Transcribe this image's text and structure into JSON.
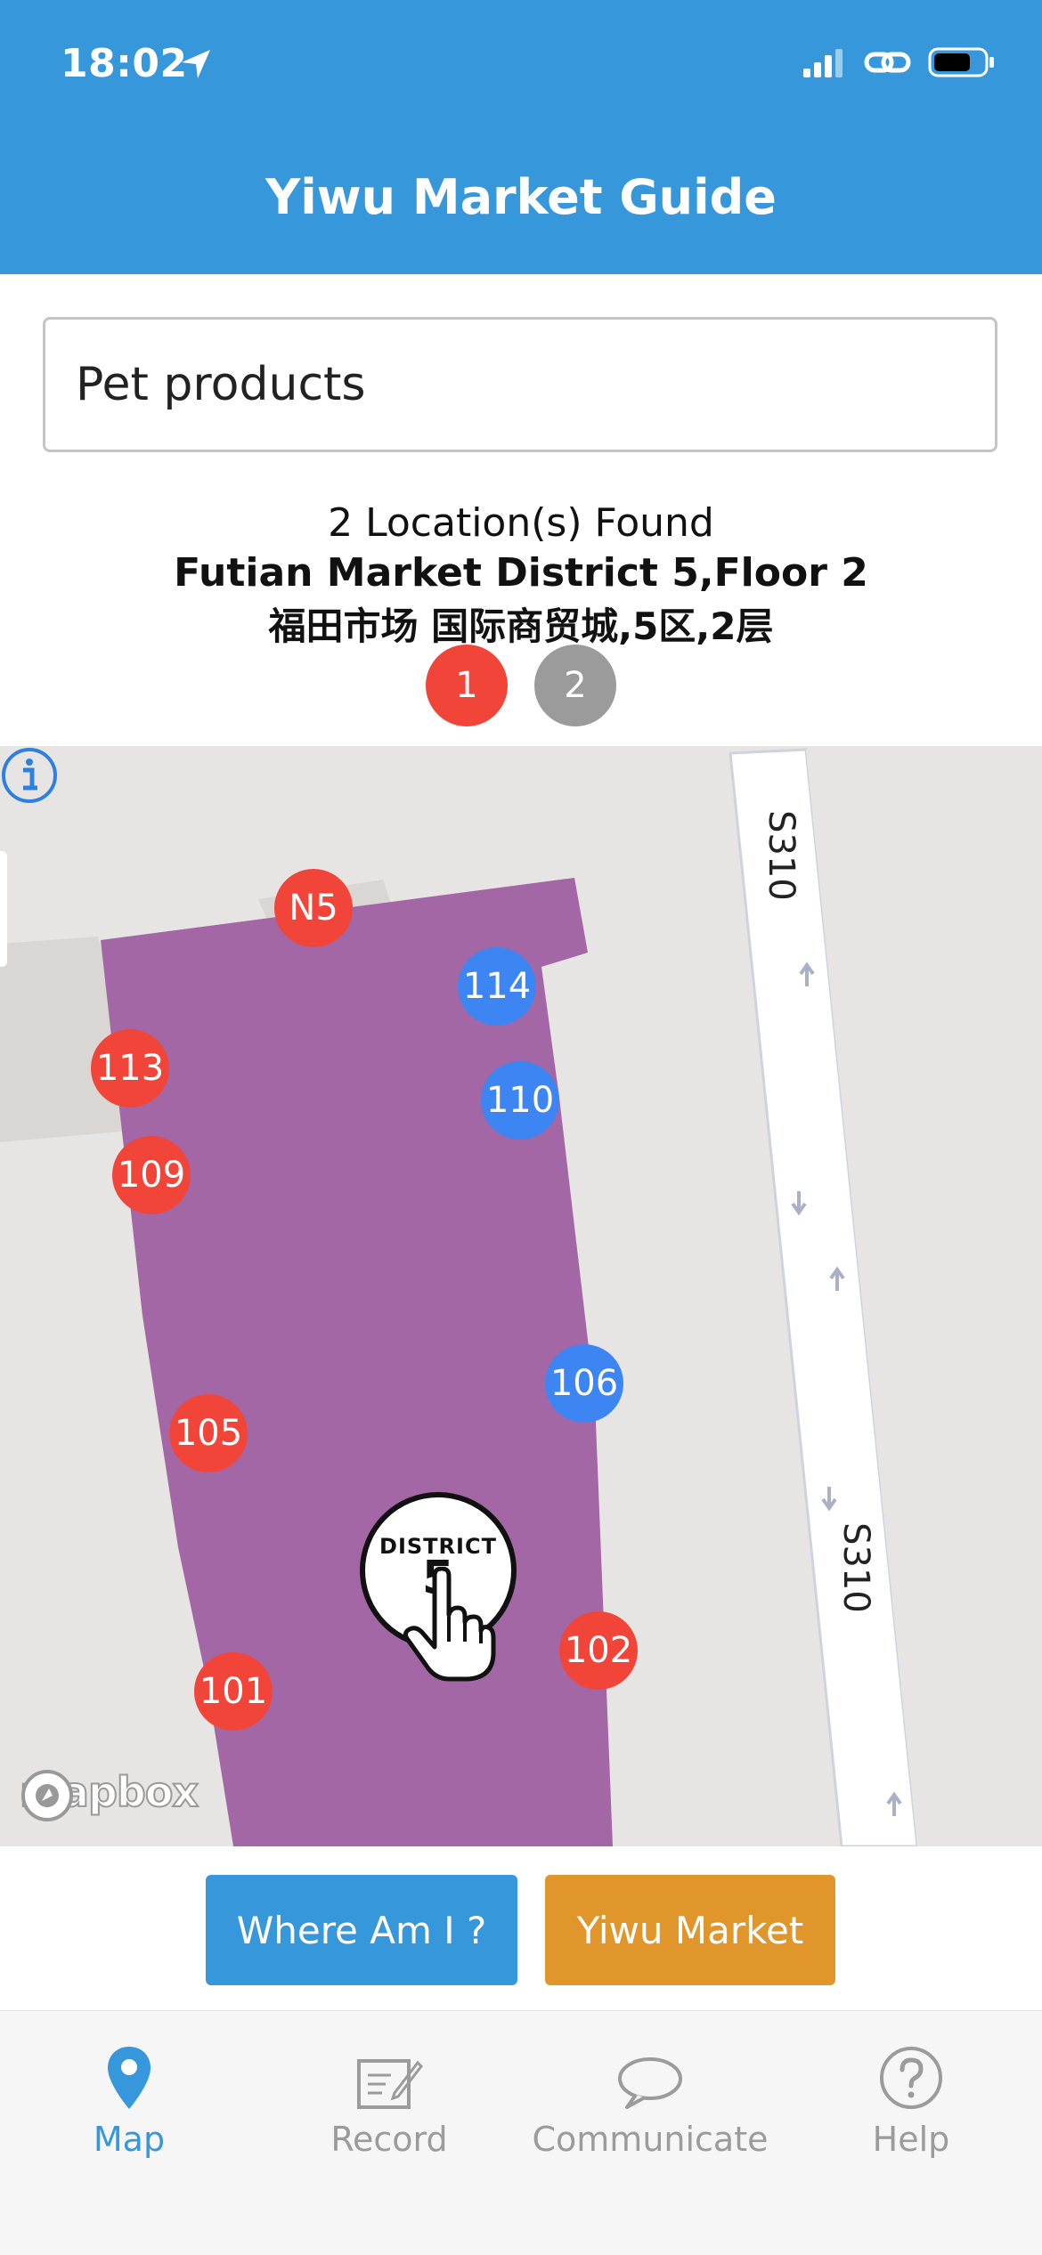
{
  "status_bar": {
    "time": "18:02"
  },
  "header": {
    "title": "Yiwu Market Guide"
  },
  "search": {
    "value": "Pet products"
  },
  "results": {
    "count_text": "2 Location(s) Found",
    "location_en": "Futian Market District 5,Floor 2",
    "location_cn": "福田市场 国际商贸城,5区,2层",
    "pages": [
      "1",
      "2"
    ],
    "active_page": "1"
  },
  "map": {
    "road_labels": [
      "S310",
      "S310"
    ],
    "markers_red": [
      "N5",
      "113",
      "109",
      "105",
      "101",
      "102"
    ],
    "markers_blue": [
      "114",
      "110",
      "106"
    ],
    "district_badge": {
      "line1": "DISTRICT",
      "line2": "5"
    },
    "attribution": "mapbox"
  },
  "buttons": {
    "where": "Where Am I ?",
    "market": "Yiwu Market"
  },
  "tabs": [
    {
      "label": "Map",
      "icon": "map-pin-icon",
      "active": true
    },
    {
      "label": "Record",
      "icon": "record-icon",
      "active": false
    },
    {
      "label": "Communicate",
      "icon": "chat-icon",
      "active": false
    },
    {
      "label": "Help",
      "icon": "help-icon",
      "active": false
    }
  ],
  "colors": {
    "primary": "#3797db",
    "accent_orange": "#e0962a",
    "marker_red": "#f2453a",
    "marker_blue": "#3e85f4",
    "district_area": "#a367a6",
    "inactive": "#9b9b9b"
  }
}
